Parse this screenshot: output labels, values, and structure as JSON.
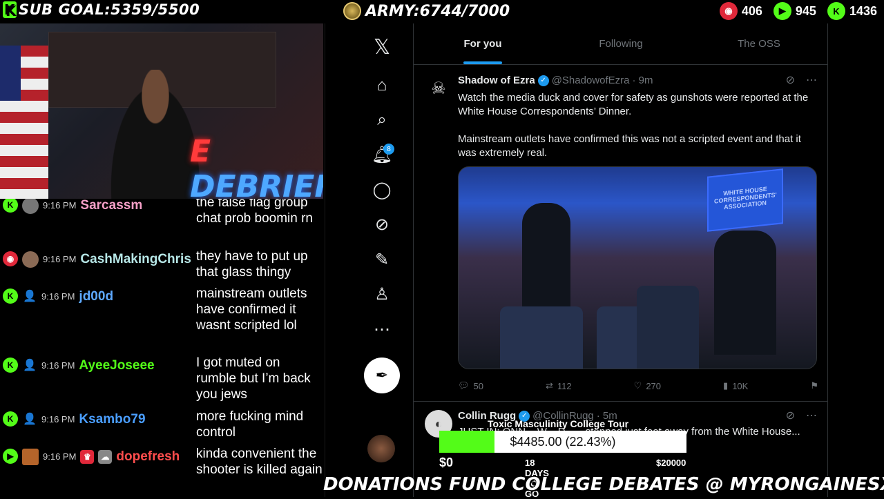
{
  "top": {
    "sub_goal": "SUB GOAL:5359/5500",
    "k_badge": "K",
    "army": "ARMY:6744/7000",
    "counters": [
      {
        "value": "406",
        "color": "#e0283a",
        "icon": "rumble-icon"
      },
      {
        "value": "945",
        "color": "#53fc18",
        "icon": "play-icon"
      },
      {
        "value": "1436",
        "color": "#53fc18",
        "icon": "kick-icon"
      }
    ]
  },
  "cam": {
    "neon_e": "E",
    "neon_text": "DEBRIEF"
  },
  "chat": {
    "messages": [
      {
        "time": "9:16 PM",
        "user": "Sarcassm",
        "color": "#f6a0c8",
        "text": "the false flag group chat prob boomin rn"
      },
      {
        "time": "9:16 PM",
        "user": "CashMakingChris",
        "color": "#b6e6e6",
        "text": "they have to put up that glass thingy"
      },
      {
        "time": "9:16 PM",
        "user": "jd00d",
        "color": "#5ea9ff",
        "text": "mainstream outlets have confirmed it wasnt scripted lol"
      },
      {
        "time": "9:16 PM",
        "user": "AyeeJoseee",
        "color": "#53fc18",
        "text": "I got muted on rumble but I’m back you jews"
      },
      {
        "time": "9:16 PM",
        "user": "Ksambo79",
        "color": "#4a9eff",
        "text": "more fucking mind control"
      },
      {
        "time": "9:16 PM",
        "user": "dopefresh",
        "color": "#ff4d4d",
        "text": "kinda convenient the shooter is killed again"
      }
    ]
  },
  "nav": {
    "notification_count": "8",
    "icons": [
      "x-logo-icon",
      "home-icon",
      "search-icon",
      "bell-icon",
      "message-icon",
      "grok-icon",
      "lists-icon",
      "profile-icon",
      "more-icon"
    ]
  },
  "tabs": [
    "For you",
    "Following",
    "The OSS"
  ],
  "tweets": [
    {
      "name": "Shadow of Ezra",
      "handle": "@ShadowofEzra",
      "time": "· 9m",
      "text1": "Watch the media duck and cover for safety as gunshots were reported at the White House Correspondents’ Dinner.",
      "text2": "Mainstream outlets have confirmed this was not a scripted event and that it was extremely real.",
      "media_screen": "WHITE HOUSE CORRESPONDENTS' ASSOCIATION",
      "replies": "50",
      "reposts": "112",
      "likes": "270",
      "views": "10K"
    },
    {
      "name": "Collin Rugg",
      "handle": "@CollinRugg",
      "time": "· 5m",
      "text": "JUST IN: ONN... W... D... ...stopped just feet away from the White House... ...was thrown to the ground by a police office..."
    }
  ],
  "overlay": {
    "title": "Toxic Masculinity College Tour",
    "amount": "$4485.00 (22.43%)",
    "progress": 0.2243,
    "min": "$0",
    "days": "18 DAYS TO GO",
    "max": "$20000"
  },
  "banner": "DONATIONS FUND COLLEGE DEBATES @ MYRONGAINESX.COM"
}
